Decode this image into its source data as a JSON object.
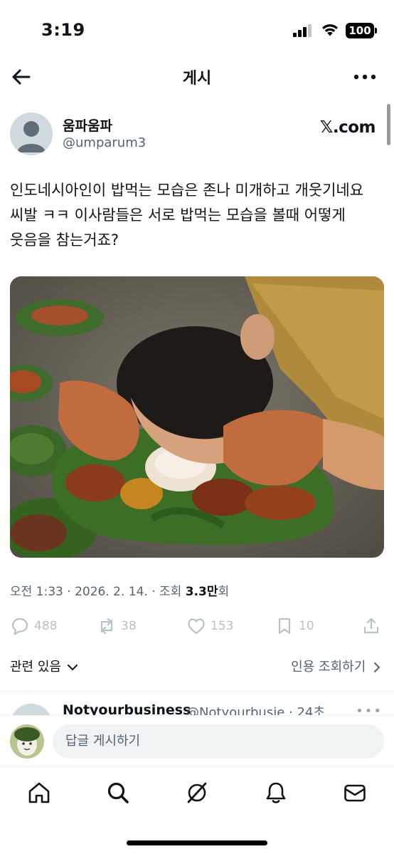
{
  "status_bar": {
    "time": "3:19",
    "battery": "100"
  },
  "nav": {
    "title": "게시",
    "back_icon": "arrow-left-icon",
    "more_icon": "more-horizontal-icon"
  },
  "post": {
    "author_name": "움파움파",
    "author_handle": "@umparum3",
    "source_label": "𝕏.com",
    "text": "인도네시아인이 밥먹는 모습은 존나 미개하고 개웃기네요 씨발 ㅋㅋ 이사람들은 서로 밥먹는 모습을 볼때 어떻게 웃음을 참는거죠?",
    "meta": {
      "timestamp": "오전 1:33 · 2026. 2. 14. · 조회",
      "views": "3.3만",
      "views_suffix": "회"
    },
    "actions": {
      "replies": "488",
      "reposts": "38",
      "likes": "153",
      "bookmarks": "10"
    }
  },
  "links": {
    "related": "관련 있음",
    "quote_views": "인용 조회하기"
  },
  "reply_preview": {
    "name": "Notyourbusiness",
    "handle": "@Notyourbusie · 24초"
  },
  "composer": {
    "placeholder": "답글 게시하기"
  },
  "tabbar": {
    "icons": [
      "home-icon",
      "search-icon",
      "grok-icon",
      "notifications-icon",
      "messages-icon"
    ]
  },
  "colors": {
    "text": "#0f1419",
    "secondary": "#536471",
    "muted_action": "#b8c2c9",
    "input_bg": "#eff3f4"
  }
}
